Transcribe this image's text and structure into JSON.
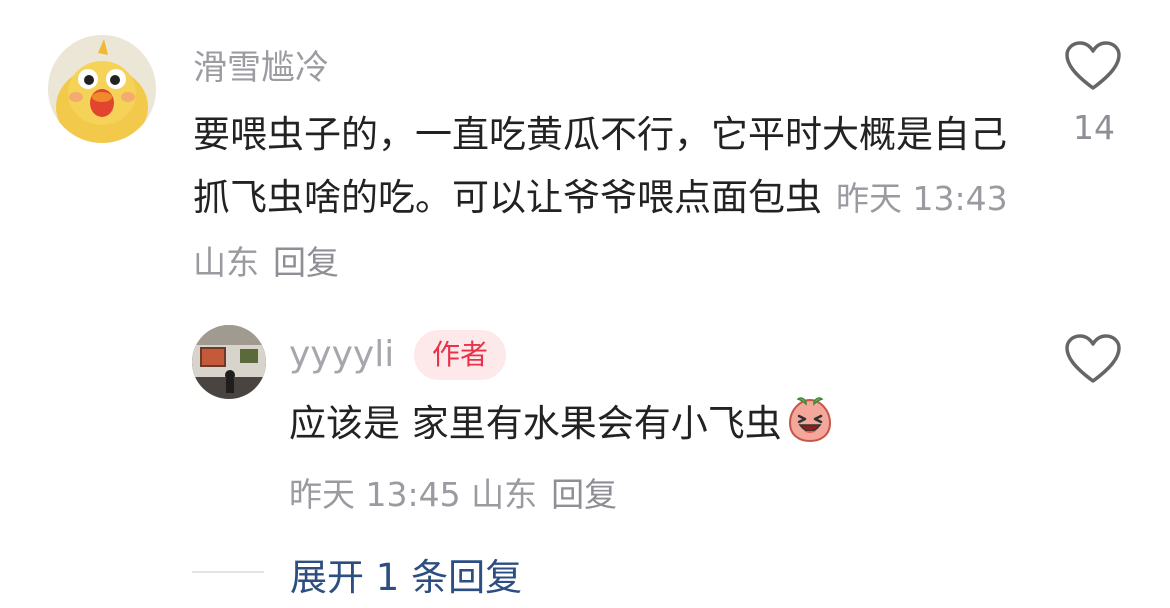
{
  "comment": {
    "username": "滑雪尴冷",
    "text": "要喂虫子的，一直吃黄瓜不行，它平时大概是自己抓飞虫啥的吃。可以让爷爷喂点面包虫",
    "meta": "昨天 13:43 山东",
    "reply_label": "回复",
    "like_count": "14",
    "avatar_icon": "yellow-chick-avatar"
  },
  "reply": {
    "username": "yyyyli",
    "author_badge": "作者",
    "text": "应该是 家里有水果会有小飞虫",
    "emoji_icon": "laughing-peach-emoji",
    "meta": "昨天 13:45 山东",
    "reply_label": "回复",
    "avatar_icon": "gallery-photo-avatar"
  },
  "expand": {
    "label": "展开 1 条回复"
  },
  "colors": {
    "badge_bg": "#fde8ea",
    "badge_text": "#e8324a",
    "link_blue": "#2d4e80",
    "muted": "#9a9aa0"
  }
}
